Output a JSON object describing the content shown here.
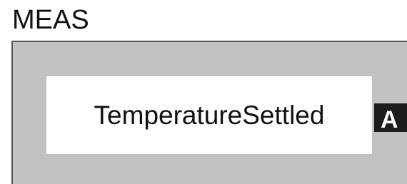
{
  "header": {
    "title": "MEAS"
  },
  "panel": {
    "status": "TemperatureSettled",
    "tag": "A"
  },
  "colors": {
    "panel_background": "#c2c2c2",
    "panel_border": "#555555",
    "status_background": "#ffffff",
    "tag_background": "#1c1c1c",
    "text": "#111111"
  }
}
